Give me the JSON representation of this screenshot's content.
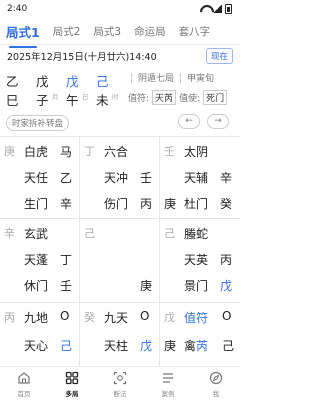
{
  "status": {
    "time": "2:40"
  },
  "tabs": [
    "局式1",
    "局式2",
    "局式3",
    "命运局",
    "套八字"
  ],
  "date": {
    "text": "2025年12月15日(十月廿六)14:40",
    "now_label": "现在"
  },
  "bazi": {
    "pillars": [
      {
        "gan": "乙",
        "zhi": "巳",
        "label": "",
        "gan_blue": false
      },
      {
        "gan": "戊",
        "zhi": "子",
        "label": "月",
        "gan_blue": false
      },
      {
        "gan": "戊",
        "zhi": "午",
        "label": "日",
        "gan_blue": true
      },
      {
        "gan": "己",
        "zhi": "未",
        "label": "时",
        "gan_blue": true
      }
    ],
    "right": {
      "ju": "阴遁七局",
      "xun": "甲寅旬",
      "zhifu_label": "值符:",
      "zhifu": "天芮",
      "zhishi_label": "值使:",
      "zhishi": "死门"
    }
  },
  "tools": {
    "convert_label": "时家拆补转盘",
    "prev": "←",
    "next": "→"
  },
  "grid": [
    {
      "gan": "庚",
      "lines": [
        [
          "白虎",
          "马"
        ],
        [
          "天任",
          "乙"
        ],
        [
          "生门",
          "辛"
        ]
      ]
    },
    {
      "gan": "丁",
      "lines": [
        [
          "六合",
          ""
        ],
        [
          "天冲",
          "壬"
        ],
        [
          "伤门",
          "丙"
        ]
      ]
    },
    {
      "gan": "壬",
      "lines": [
        [
          "太阴",
          ""
        ],
        [
          "天辅",
          "辛"
        ],
        [
          "杜门",
          "癸"
        ]
      ],
      "third_prefix": "庚"
    },
    {
      "gan": "辛",
      "lines": [
        [
          "玄武",
          ""
        ],
        [
          "天蓬",
          "丁"
        ],
        [
          "休门",
          "壬"
        ]
      ]
    },
    {
      "gan": "己",
      "lines": [
        [
          "",
          ""
        ],
        [
          "",
          ""
        ],
        [
          "",
          "庚"
        ]
      ]
    },
    {
      "gan": "己",
      "lines": [
        [
          "螣蛇",
          ""
        ],
        [
          "天英",
          "丙"
        ],
        [
          "景门",
          "戊"
        ]
      ],
      "blue_side": [
        false,
        false,
        true
      ]
    },
    {
      "gan": "丙",
      "lines": [
        [
          "九地",
          "O"
        ],
        [
          "天心",
          "己"
        ]
      ],
      "blue_side": [
        false,
        true
      ]
    },
    {
      "gan": "癸",
      "lines": [
        [
          "九天",
          "O"
        ],
        [
          "天柱",
          "戊"
        ]
      ],
      "blue_side": [
        false,
        true
      ]
    },
    {
      "gan": "戊",
      "lines": [
        [
          "值符",
          "O"
        ],
        [
          "天芮",
          ""
        ]
      ],
      "blue_text": [
        true,
        false
      ],
      "second_prefix": "庚",
      "second_extra": "禽",
      "second_extra2": "芮",
      "second_side2": "己"
    }
  ],
  "nav": [
    {
      "label": "首页",
      "icon": "home-icon"
    },
    {
      "label": "多局",
      "icon": "grid-icon"
    },
    {
      "label": "断法",
      "icon": "scan-icon"
    },
    {
      "label": "案例",
      "icon": "list-icon"
    },
    {
      "label": "我",
      "icon": "compass-icon"
    }
  ]
}
